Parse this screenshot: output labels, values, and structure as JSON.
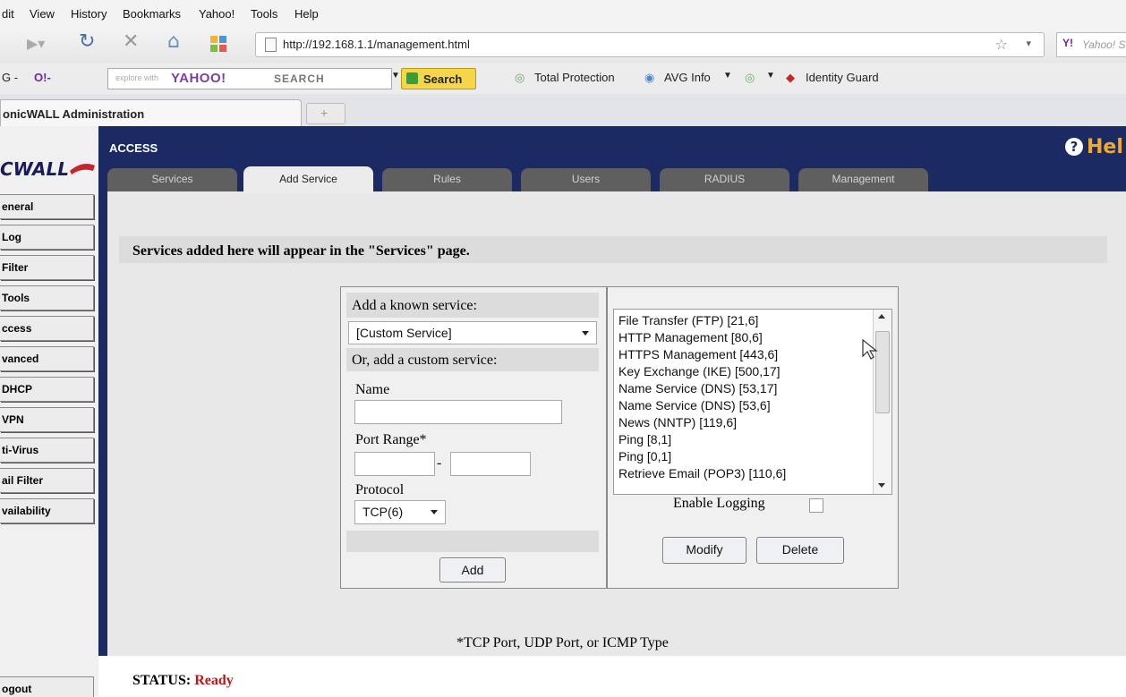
{
  "menu": [
    "dit",
    "View",
    "History",
    "Bookmarks",
    "Yahoo!",
    "Tools",
    "Help"
  ],
  "nav": {
    "url": "http://192.168.1.1/management.html",
    "search_placeholder": "Yahoo! Search",
    "search_badge": "Y!"
  },
  "toolbar": {
    "prefix": "G -",
    "yahoo_badge": "O!-",
    "search_hint": "explore with",
    "search_brand": "YAHOO!",
    "search_word": "SEARCH",
    "search_button": "Search",
    "total_protection": "Total Protection",
    "avg_info": "AVG Info",
    "identity_guard": "Identity Guard"
  },
  "browser_tab": {
    "title": "onicWALL Administration",
    "new_tab": "+"
  },
  "sidebar": {
    "logo": "CWALL",
    "items": [
      "eneral",
      "Log",
      "Filter",
      "Tools",
      "ccess",
      "vanced",
      "DHCP",
      "VPN",
      "ti-Virus",
      "ail Filter",
      "vailability"
    ],
    "logout": "ogout"
  },
  "header": {
    "section": "ACCESS",
    "help": "Hel"
  },
  "tabs": [
    "Services",
    "Add Service",
    "Rules",
    "Users",
    "RADIUS",
    "Management"
  ],
  "active_tab": "Add Service",
  "info": "Services added here will appear in the \"Services\" page.",
  "form": {
    "known_service_label": "Add a known service:",
    "known_service_value": "[Custom Service]",
    "custom_label": "Or, add a custom service:",
    "name_label": "Name",
    "name_value": "",
    "port_range_label": "Port Range*",
    "port_from": "",
    "port_sep": "-",
    "port_to": "",
    "protocol_label": "Protocol",
    "protocol_value": "TCP(6)",
    "add_button": "Add"
  },
  "services_list": [
    "File Transfer (FTP) [21,6]",
    "HTTP Management [80,6]",
    "HTTPS Management [443,6]",
    "Key Exchange (IKE) [500,17]",
    "Name Service (DNS) [53,17]",
    "Name Service (DNS) [53,6]",
    "News (NNTP) [119,6]",
    "Ping [8,1]",
    "Ping [0,1]",
    "Retrieve Email (POP3) [110,6]"
  ],
  "enable_logging_label": "Enable Logging",
  "modify_button": "Modify",
  "delete_button": "Delete",
  "footnote": "*TCP Port, UDP Port, or ICMP Type",
  "status": {
    "label": "STATUS:",
    "value": "Ready"
  }
}
